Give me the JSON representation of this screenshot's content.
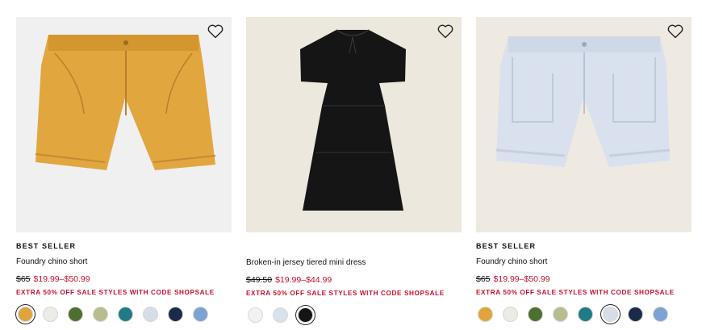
{
  "products": [
    {
      "badge": "BEST SELLER",
      "title": "Foundry chino short",
      "was_price": "$65",
      "sale_price": "$19.99–$50.99",
      "promo": "EXTRA 50% OFF SALE STYLES WITH CODE SHOPSALE",
      "image_bg": "#f0f0f0",
      "garment_color": "#e2a63f",
      "swatches": [
        "#e1a33c",
        "#ecebe5",
        "#4d7030",
        "#b9bd8e",
        "#1f7c85",
        "#d7dde6",
        "#1c2a4a",
        "#7ba3d3"
      ],
      "selected_swatch": 0
    },
    {
      "badge": "",
      "title": "Broken-in jersey tiered mini dress",
      "was_price": "$49.50",
      "sale_price": "$19.99–$44.99",
      "promo": "EXTRA 50% OFF SALE STYLES WITH CODE SHOPSALE",
      "image_bg": "#ede8de",
      "garment_color": "#151515",
      "swatches": [
        "#f2f2f2",
        "#d8e2ec",
        "#151515"
      ],
      "selected_swatch": 2
    },
    {
      "badge": "BEST SELLER",
      "title": "Foundry chino short",
      "was_price": "$65",
      "sale_price": "$19.99–$50.99",
      "promo": "EXTRA 50% OFF SALE STYLES WITH CODE SHOPSALE",
      "image_bg": "#eeeae1",
      "garment_color": "#d9e1ee",
      "swatches": [
        "#e1a33c",
        "#ecebe5",
        "#4d7030",
        "#b9bd8e",
        "#1f7c85",
        "#d7dde6",
        "#1c2a4a",
        "#7ba3d3"
      ],
      "selected_swatch": 5
    }
  ]
}
